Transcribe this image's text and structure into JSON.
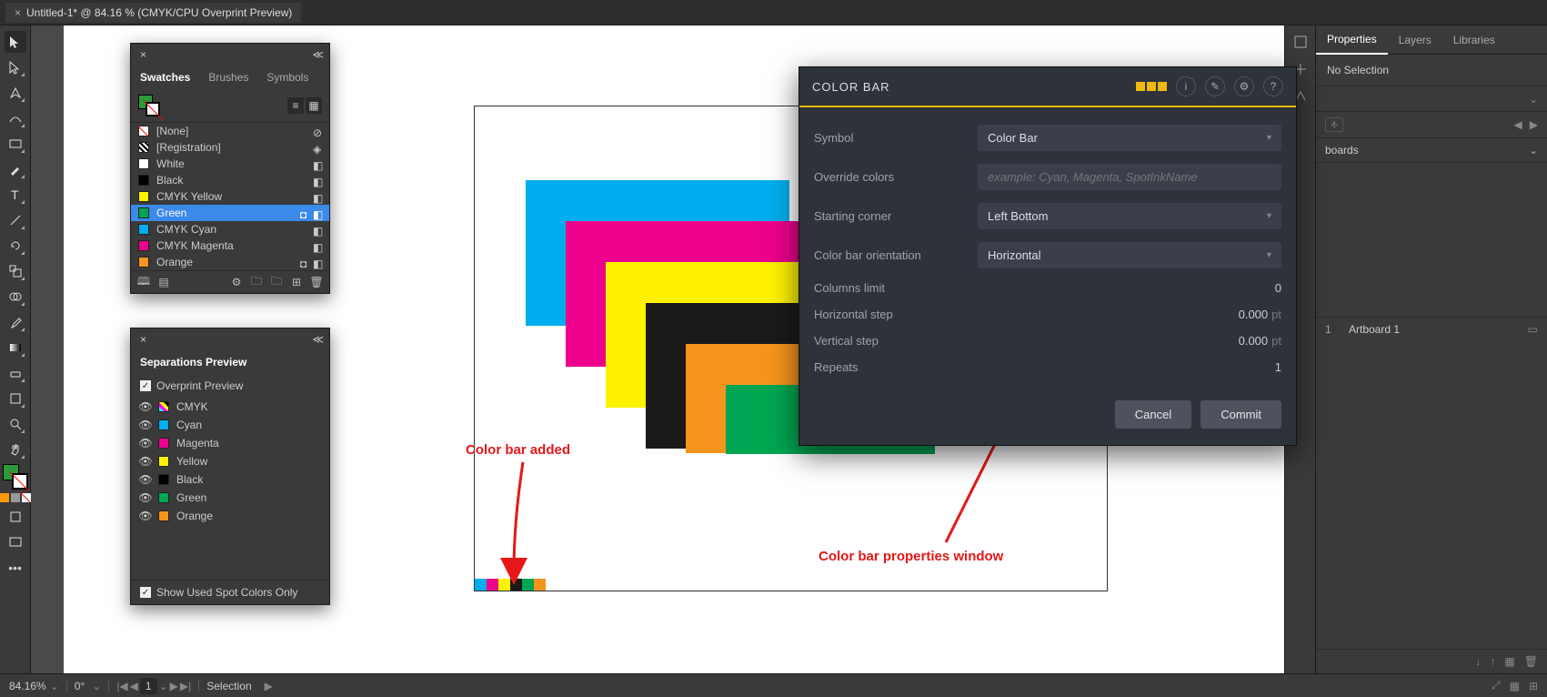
{
  "document": {
    "tab_title": "Untitled-1* @ 84.16 % (CMYK/CPU Overprint Preview)"
  },
  "status": {
    "zoom": "84.16%",
    "rotation": "0°",
    "nav_value": "1",
    "mode": "Selection"
  },
  "swatches_panel": {
    "tabs": [
      "Swatches",
      "Brushes",
      "Symbols"
    ],
    "items": [
      {
        "name": "[None]"
      },
      {
        "name": "[Registration]"
      },
      {
        "name": "White"
      },
      {
        "name": "Black"
      },
      {
        "name": "CMYK Yellow"
      },
      {
        "name": "Green"
      },
      {
        "name": "CMYK Cyan"
      },
      {
        "name": "CMYK Magenta"
      },
      {
        "name": "Orange"
      }
    ]
  },
  "separations_panel": {
    "title": "Separations Preview",
    "overprint_label": "Overprint Preview",
    "items": [
      "CMYK",
      "Cyan",
      "Magenta",
      "Yellow",
      "Black",
      "Green",
      "Orange"
    ],
    "show_used_label": "Show Used Spot Colors Only"
  },
  "right_panel": {
    "tabs": [
      "Properties",
      "Layers",
      "Libraries"
    ],
    "no_selection": "No Selection",
    "artboards_label": "boards",
    "artboards": [
      {
        "num": "1",
        "name": "Artboard 1"
      }
    ]
  },
  "plugin": {
    "title": "COLOR BAR",
    "fields": {
      "symbol_label": "Symbol",
      "symbol_value": "Color Bar",
      "override_label": "Override colors",
      "override_placeholder": "example: Cyan, Magenta, SpotInkName",
      "corner_label": "Starting corner",
      "corner_value": "Left Bottom",
      "orientation_label": "Color bar orientation",
      "orientation_value": "Horizontal",
      "columns_label": "Columns limit",
      "columns_value": "0",
      "hstep_label": "Horizontal step",
      "hstep_value": "0.000",
      "hstep_unit": "pt",
      "vstep_label": "Vertical step",
      "vstep_value": "0.000",
      "vstep_unit": "pt",
      "repeats_label": "Repeats",
      "repeats_value": "1"
    },
    "cancel": "Cancel",
    "commit": "Commit"
  },
  "annotations": {
    "cb_added": "Color bar added",
    "cb_props": "Color bar properties window"
  },
  "colors": {
    "cyan": "#00aeef",
    "magenta": "#ec008c",
    "yellow": "#fff200",
    "black": "#1a1a1a",
    "orange": "#f7941d",
    "green": "#00a651"
  }
}
